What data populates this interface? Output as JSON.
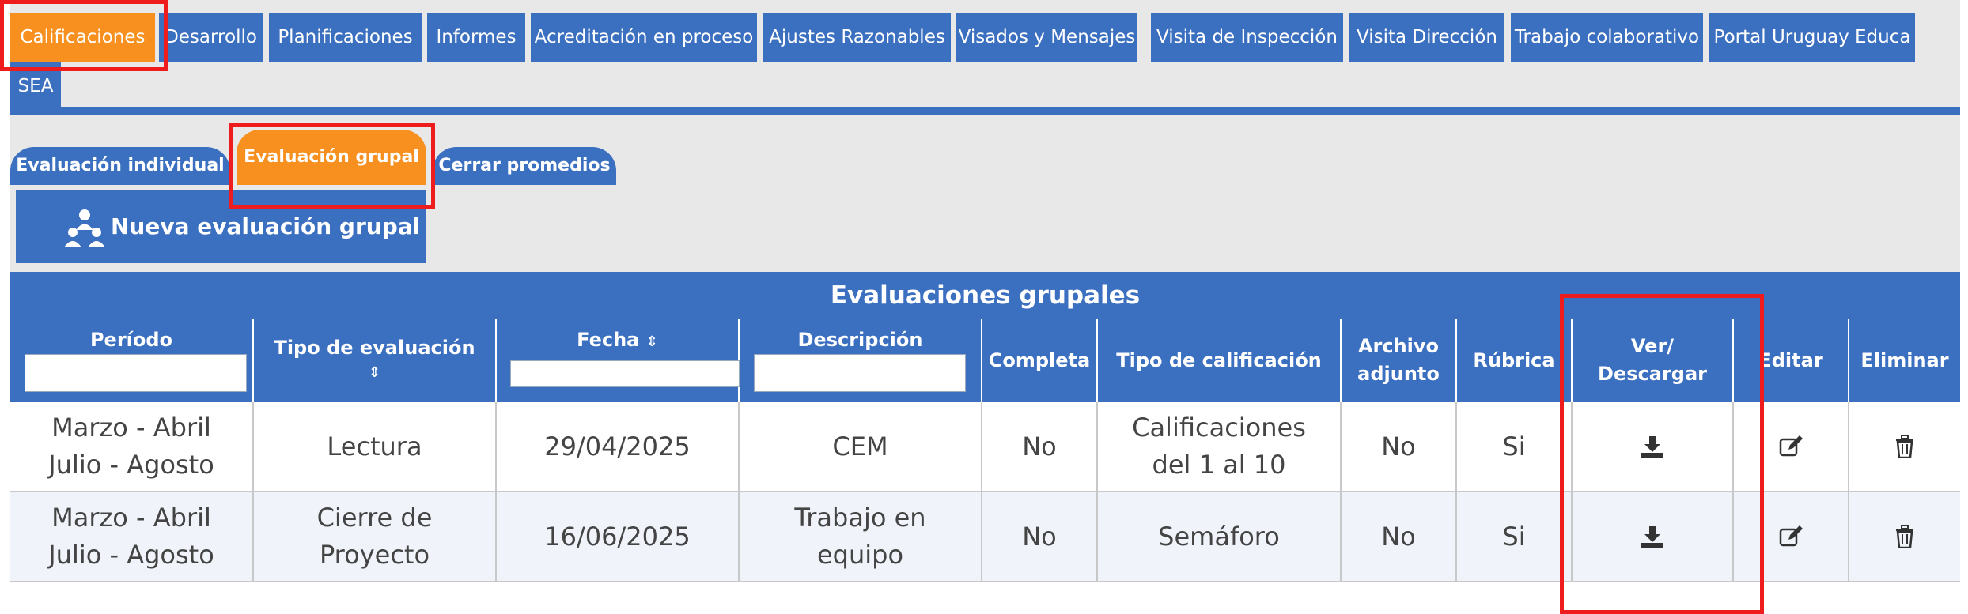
{
  "menu": {
    "tabs": [
      {
        "label": "Calificaciones",
        "active": true
      },
      {
        "label": "Desarrollo"
      },
      {
        "label": "Planificaciones"
      },
      {
        "label": "Informes"
      },
      {
        "label": "Acreditación en proceso"
      },
      {
        "label": "Ajustes Razonables"
      },
      {
        "label": "Visados y Mensajes"
      },
      {
        "label": "Visita de Inspección"
      },
      {
        "label": "Visita Dirección"
      },
      {
        "label": "Trabajo colaborativo"
      },
      {
        "label": "Portal Uruguay Educa"
      },
      {
        "label": "SEA"
      }
    ]
  },
  "sub_tabs": [
    {
      "label": "Evaluación individual"
    },
    {
      "label": "Evaluación grupal",
      "active": true
    },
    {
      "label": "Cerrar promedios"
    }
  ],
  "new_eval_button": {
    "label": "Nueva evaluación grupal",
    "icon": "group-users-icon"
  },
  "table": {
    "title": "Evaluaciones grupales",
    "headers": {
      "periodo": "Período",
      "tipo_evaluacion": "Tipo de evaluación",
      "fecha": "Fecha",
      "descripcion": "Descripción",
      "completa": "Completa",
      "tipo_calificacion": "Tipo de calificación",
      "archivo_line1": "Archivo",
      "archivo_line2": "adjunto",
      "rubrica": "Rúbrica",
      "ver_line1": "Ver/",
      "ver_line2": "Descargar",
      "editar": "Editar",
      "eliminar": "Eliminar"
    },
    "sort_icon": "⇕",
    "filters": {
      "periodo": "",
      "fecha": "",
      "descripcion": ""
    },
    "rows": [
      {
        "periodo_1": "Marzo - Abril",
        "periodo_2": "Julio - Agosto",
        "tipo_1": "Lectura",
        "tipo_2": "",
        "fecha": "29/04/2025",
        "descripcion_1": "CEM",
        "descripcion_2": "",
        "completa": "No",
        "calificacion_1": "Calificaciones",
        "calificacion_2": "del 1 al 10",
        "archivo": "No",
        "rubrica": "Si"
      },
      {
        "periodo_1": "Marzo - Abril",
        "periodo_2": "Julio - Agosto",
        "tipo_1": "Cierre de",
        "tipo_2": "Proyecto",
        "fecha": "16/06/2025",
        "descripcion_1": "Trabajo en",
        "descripcion_2": "equipo",
        "completa": "No",
        "calificacion_1": "Semáforo",
        "calificacion_2": "",
        "archivo": "No",
        "rubrica": "Si"
      }
    ]
  },
  "colors": {
    "blue": "#3b6fc0",
    "orange": "#f7901e",
    "highlight_red": "#ee1c1c",
    "gray_bg": "#e8e8e8"
  }
}
